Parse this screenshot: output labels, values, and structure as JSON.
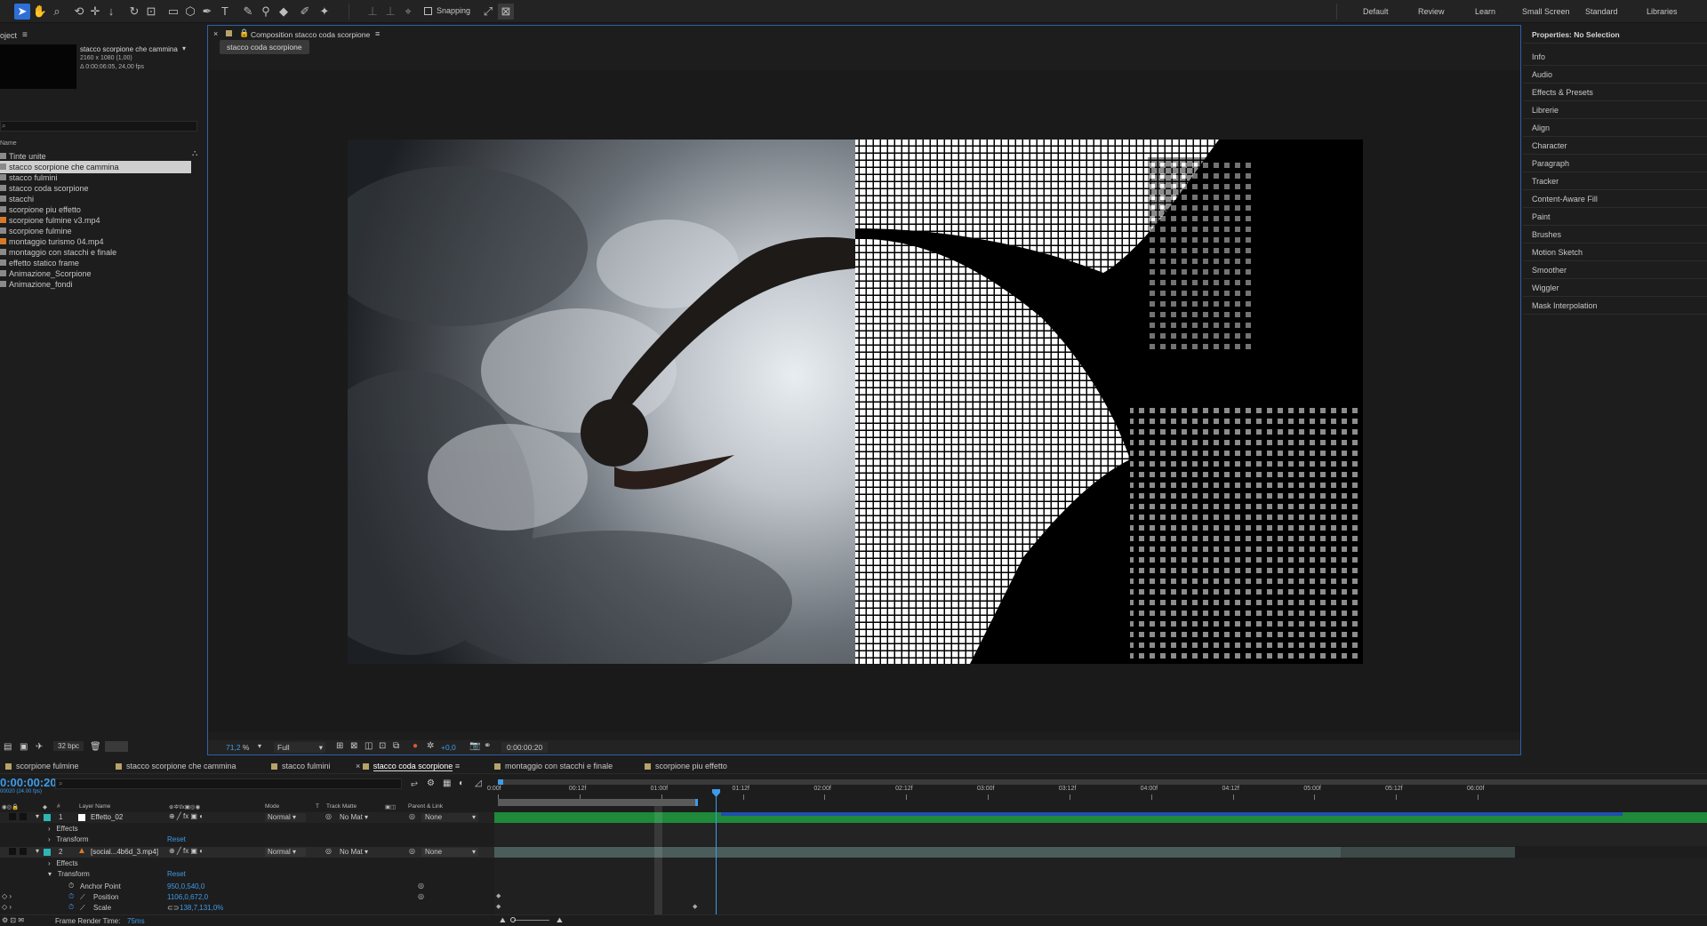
{
  "toolbar": {
    "snapping_label": "Snapping",
    "workspaces": [
      "Default",
      "Review",
      "Learn",
      "Small Screen",
      "Standard",
      "Libraries"
    ]
  },
  "project": {
    "title": "oject",
    "comp_name": "stacco scorpione che cammina",
    "comp_dims": "2160 x 1080 (1,00)",
    "comp_duration": "Δ 0:00:06:05, 24,00 fps",
    "column_name": "Name",
    "items": [
      {
        "label": "Tinte unite",
        "type": "folder"
      },
      {
        "label": "stacco scorpione che cammina",
        "type": "comp",
        "selected": true
      },
      {
        "label": "stacco fulmini",
        "type": "comp"
      },
      {
        "label": "stacco coda scorpione",
        "type": "comp"
      },
      {
        "label": "stacchi",
        "type": "folder"
      },
      {
        "label": "scorpione piu effetto",
        "type": "comp"
      },
      {
        "label": "scorpione fulmine v3.mp4",
        "type": "footage"
      },
      {
        "label": "scorpione fulmine",
        "type": "comp"
      },
      {
        "label": "montaggio turismo 04.mp4",
        "type": "footage"
      },
      {
        "label": "montaggio con stacchi e finale",
        "type": "comp"
      },
      {
        "label": "effetto statico frame",
        "type": "comp"
      },
      {
        "label": "Animazione_Scorpione",
        "type": "folder"
      },
      {
        "label": "Animazione_fondi",
        "type": "folder"
      }
    ],
    "bpc": "32 bpc"
  },
  "viewer": {
    "tab_title": "Composition stacco coda scorpione",
    "comp_chip": "stacco coda scorpione",
    "zoom": "71,2",
    "zoom_unit": "%",
    "resolution": "Full",
    "exposure": "+0,0",
    "timecode": "0:00:00:20"
  },
  "properties": {
    "title": "Properties: No Selection",
    "items": [
      "Info",
      "Audio",
      "Effects & Presets",
      "Librerie",
      "Align",
      "Character",
      "Paragraph",
      "Tracker",
      "Content-Aware Fill",
      "Paint",
      "Brushes",
      "Motion Sketch",
      "Smoother",
      "Wiggler",
      "Mask Interpolation"
    ]
  },
  "timeline": {
    "tabs": [
      "scorpione fulmine",
      "stacco scorpione che cammina",
      "stacco fulmini",
      "stacco coda scorpione",
      "montaggio con stacchi e finale",
      "scorpione piu effetto"
    ],
    "active_tab": "stacco coda scorpione",
    "current_time": "0:00:00:20",
    "fps_note": "00020 (24.00 fps)",
    "columns": {
      "layer_name": "Layer Name",
      "mode": "Mode",
      "t": "T",
      "track_matte": "Track Matte",
      "parent": "Parent & Link"
    },
    "layers": [
      {
        "num": "1",
        "name": "Effetto_02",
        "mode": "Normal",
        "matte": "No Mat",
        "parent": "None",
        "color": "#2fb5b5"
      },
      {
        "num": "2",
        "name": "[social...4b6d_3.mp4]",
        "mode": "Normal",
        "matte": "No Mat",
        "parent": "None",
        "color": "#2fb5b5"
      }
    ],
    "props": {
      "effects": "Effects",
      "transform": "Transform",
      "reset": "Reset",
      "anchor_label": "Anchor Point",
      "anchor_value": "950,0,540,0",
      "position_label": "Position",
      "position_value": "1106,0,672,0",
      "scale_label": "Scale",
      "scale_value": "138,7,131,0%"
    },
    "ruler": [
      "0:00f",
      "00:12f",
      "01:00f",
      "01:12f",
      "02:00f",
      "02:12f",
      "03:00f",
      "03:12f",
      "04:00f",
      "04:12f",
      "05:00f",
      "05:12f",
      "06:00f"
    ],
    "playhead_fraction": 0.111,
    "render_time_label": "Frame Render Time:",
    "render_time_value": "75ms"
  },
  "colors": {
    "accent": "#2d6fd6",
    "timecode": "#3d9be9",
    "layer_label": "#2fb5b5",
    "track_green": "#1e8a3a",
    "track_blue": "#1f4fb0"
  }
}
